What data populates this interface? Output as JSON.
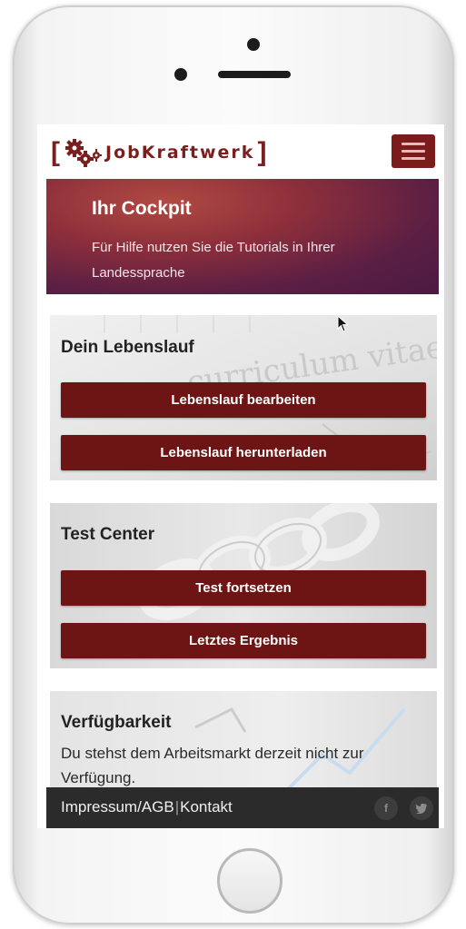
{
  "header": {
    "logo_bracket_open": "[",
    "logo_text": "JobKraftwerk",
    "logo_bracket_close": "]"
  },
  "hero": {
    "title": "Ihr Cockpit",
    "subtitle": "Für Hilfe nutzen Sie die Tutorials in Ihrer Landessprache",
    "background_text": "curriculum vitae"
  },
  "cards": {
    "cv": {
      "title": "Dein Lebenslauf",
      "edit_button": "Lebenslauf bearbeiten",
      "download_button": "Lebenslauf herunterladen"
    },
    "test": {
      "title": "Test Center",
      "continue_button": "Test fortsetzen",
      "result_button": "Letztes Ergebnis"
    },
    "availability": {
      "title": "Verfügbarkeit",
      "text": "Du stehst dem Arbeitsmarkt derzeit nicht zur Verfügung."
    }
  },
  "footer": {
    "imprint": "Impressum/AGB",
    "separator": "|",
    "contact": "Kontakt",
    "social_facebook": "f",
    "social_twitter": "t"
  },
  "colors": {
    "brand": "#7a1f1f",
    "button": "#6d1515",
    "footer": "#2b2b2b"
  }
}
